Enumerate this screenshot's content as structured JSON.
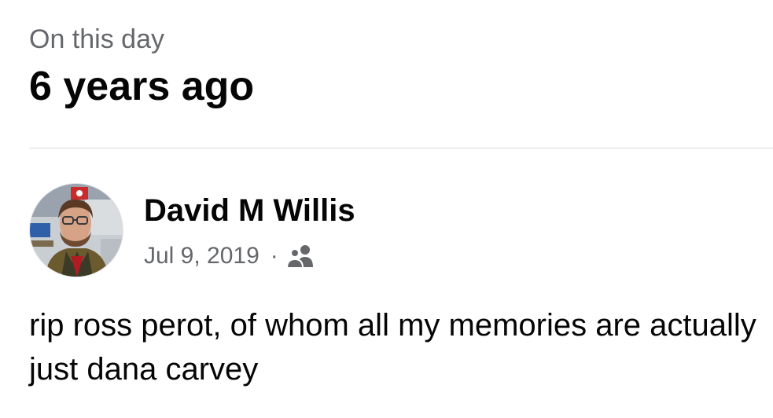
{
  "memory_header": {
    "label": "On this day",
    "time_ago": "6 years ago"
  },
  "post": {
    "author": {
      "name": "David M Willis",
      "avatar": "profile-photo"
    },
    "date": "Jul 9, 2019",
    "separator": "·",
    "audience_icon": "friends-icon",
    "text": "rip ross perot, of whom all my memories are actually just dana carvey"
  },
  "colors": {
    "primary_text": "#050505",
    "secondary_text": "#65676b",
    "divider": "#dcdde1",
    "background": "#ffffff"
  }
}
